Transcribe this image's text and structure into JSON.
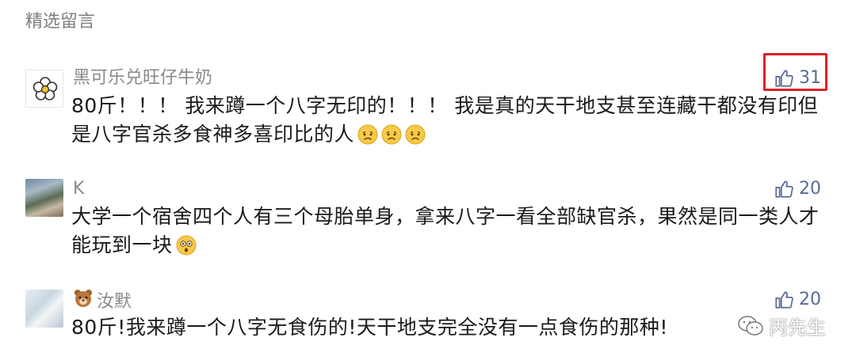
{
  "section": {
    "title": "精选留言"
  },
  "comments": [
    {
      "nickname": "黑可乐兑旺仔牛奶",
      "content": "80斤！！！ 我来蹲一个八字无印的！！！ 我是真的天干地支甚至连藏干都没有印但是八字官杀多食神多喜印比的人",
      "likes": "31",
      "emoji": "sad-face-emoji"
    },
    {
      "nickname": "K",
      "content": "大学一个宿舍四个人有三个母胎单身，拿来八字一看全部缺官杀，果然是同一类人才能玩到一块",
      "likes": "20",
      "emoji": "shocked-face-emoji"
    },
    {
      "nickname": "汝默",
      "nickname_prefix_icon": "bear-emoji",
      "content": "80斤!我来蹲一个八字无食伤的!天干地支完全没有一点食伤的那种!",
      "likes": "20"
    }
  ],
  "watermark": {
    "text": "丙先生",
    "icon": "wechat-icon"
  },
  "colors": {
    "like": "#576b95",
    "highlight": "#e02020",
    "nickname": "#8a8a8a",
    "text": "#1a1a1a"
  }
}
